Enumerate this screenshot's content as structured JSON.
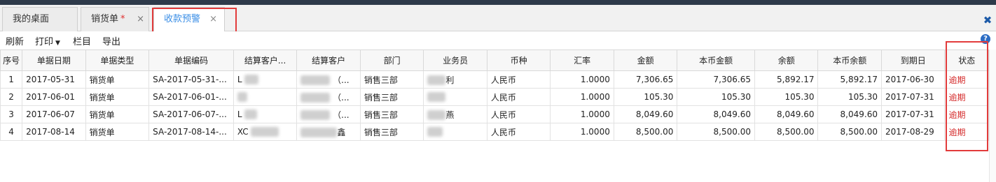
{
  "tabs": [
    {
      "label": "我的桌面",
      "closable": false,
      "modified": false
    },
    {
      "label": "销货单",
      "closable": true,
      "modified": true
    },
    {
      "label": "收款预警",
      "closable": true,
      "modified": false,
      "active": true
    }
  ],
  "tab_modified_mark": "*",
  "tab_close_glyph": "×",
  "close_all_glyph": "✖",
  "toolbar": {
    "refresh": "刷新",
    "print": "打印",
    "columns": "栏目",
    "export": "导出",
    "help": "?"
  },
  "table": {
    "headers": [
      "序号",
      "单据日期",
      "单据类型",
      "单据编码",
      "结算客户...",
      "结算客户",
      "部门",
      "业务员",
      "币种",
      "汇率",
      "金额",
      "本币金额",
      "余额",
      "本币余额",
      "到期日",
      "状态"
    ],
    "rows": [
      {
        "no": "1",
        "date": "2017-05-31",
        "type": "销货单",
        "code": "SA-2017-05-31-...",
        "cust_code": "L",
        "cust_name": "（...",
        "dept": "销售三部",
        "staff": "利",
        "currency": "人民币",
        "rate": "1.0000",
        "amount": "7,306.65",
        "local_amount": "7,306.65",
        "balance": "5,892.17",
        "local_balance": "5,892.17",
        "due": "2017-06-30",
        "status": "逾期"
      },
      {
        "no": "2",
        "date": "2017-06-01",
        "type": "销货单",
        "code": "SA-2017-06-01-...",
        "cust_code": "",
        "cust_name": "（...",
        "dept": "销售三部",
        "staff": "",
        "currency": "人民币",
        "rate": "1.0000",
        "amount": "105.30",
        "local_amount": "105.30",
        "balance": "105.30",
        "local_balance": "105.30",
        "due": "2017-07-31",
        "status": "逾期"
      },
      {
        "no": "3",
        "date": "2017-06-07",
        "type": "销货单",
        "code": "SA-2017-06-07-...",
        "cust_code": "L",
        "cust_name": "（...",
        "dept": "销售三部",
        "staff": "燕",
        "currency": "人民币",
        "rate": "1.0000",
        "amount": "8,049.60",
        "local_amount": "8,049.60",
        "balance": "8,049.60",
        "local_balance": "8,049.60",
        "due": "2017-07-31",
        "status": "逾期"
      },
      {
        "no": "4",
        "date": "2017-08-14",
        "type": "销货单",
        "code": "SA-2017-08-14-...",
        "cust_code": "XC",
        "cust_name": "鑫",
        "dept": "销售三部",
        "staff": "",
        "currency": "人民币",
        "rate": "1.0000",
        "amount": "8,500.00",
        "local_amount": "8,500.00",
        "balance": "8,500.00",
        "local_balance": "8,500.00",
        "due": "2017-08-29",
        "status": "逾期"
      }
    ]
  },
  "colors": {
    "accent": "#3a8ee6",
    "highlight": "#e23b3b",
    "overdue": "#d42a2a",
    "topbar": "#2e3a4a"
  }
}
